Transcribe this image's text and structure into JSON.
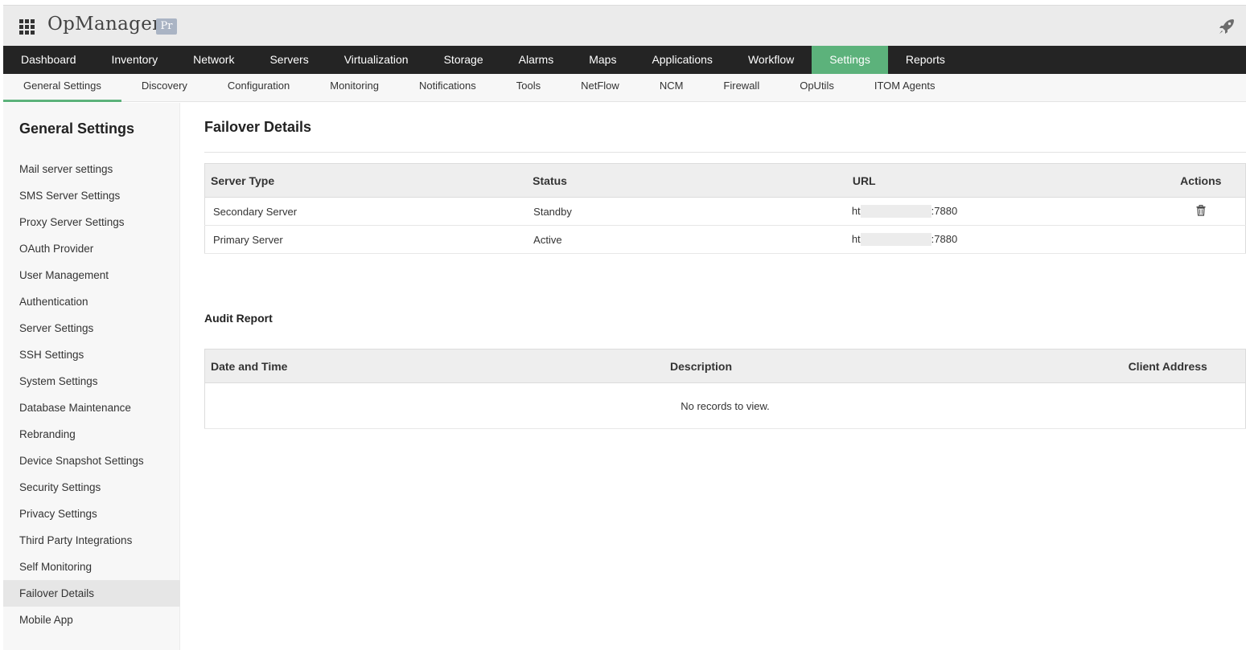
{
  "header": {
    "app_title": "OpManager",
    "edition_badge": "Pr"
  },
  "main_nav": {
    "tabs": [
      {
        "label": "Dashboard"
      },
      {
        "label": "Inventory"
      },
      {
        "label": "Network"
      },
      {
        "label": "Servers"
      },
      {
        "label": "Virtualization"
      },
      {
        "label": "Storage"
      },
      {
        "label": "Alarms"
      },
      {
        "label": "Maps"
      },
      {
        "label": "Applications"
      },
      {
        "label": "Workflow"
      },
      {
        "label": "Settings",
        "active": true
      },
      {
        "label": "Reports"
      }
    ]
  },
  "sub_nav": {
    "tabs": [
      {
        "label": "General Settings",
        "active": true
      },
      {
        "label": "Discovery"
      },
      {
        "label": "Configuration"
      },
      {
        "label": "Monitoring"
      },
      {
        "label": "Notifications"
      },
      {
        "label": "Tools"
      },
      {
        "label": "NetFlow"
      },
      {
        "label": "NCM"
      },
      {
        "label": "Firewall"
      },
      {
        "label": "OpUtils"
      },
      {
        "label": "ITOM Agents"
      }
    ]
  },
  "sidebar": {
    "title": "General Settings",
    "items": [
      {
        "label": "Mail server settings"
      },
      {
        "label": "SMS Server Settings"
      },
      {
        "label": "Proxy Server Settings"
      },
      {
        "label": "OAuth Provider"
      },
      {
        "label": "User Management"
      },
      {
        "label": "Authentication"
      },
      {
        "label": "Server Settings"
      },
      {
        "label": "SSH Settings"
      },
      {
        "label": "System Settings"
      },
      {
        "label": "Database Maintenance"
      },
      {
        "label": "Rebranding"
      },
      {
        "label": "Device Snapshot Settings"
      },
      {
        "label": "Security Settings"
      },
      {
        "label": "Privacy Settings"
      },
      {
        "label": "Third Party Integrations"
      },
      {
        "label": "Self Monitoring"
      },
      {
        "label": "Failover Details",
        "active": true
      },
      {
        "label": "Mobile App"
      }
    ]
  },
  "main": {
    "title": "Failover Details",
    "failover_table": {
      "headers": [
        "Server Type",
        "Status",
        "URL",
        "Actions"
      ],
      "rows": [
        {
          "server_type": "Secondary Server",
          "status": "Standby",
          "url_prefix": "ht",
          "url_suffix": ":7880",
          "action_icon": "trash-icon"
        },
        {
          "server_type": "Primary Server",
          "status": "Active",
          "url_prefix": "ht",
          "url_suffix": ":7880"
        }
      ]
    },
    "audit": {
      "title": "Audit Report",
      "headers": [
        "Date and Time",
        "Description",
        "Client Address"
      ],
      "empty_message": "No records to view."
    }
  },
  "colors": {
    "accent_green": "#5cb27b",
    "nav_dark": "#242424"
  }
}
